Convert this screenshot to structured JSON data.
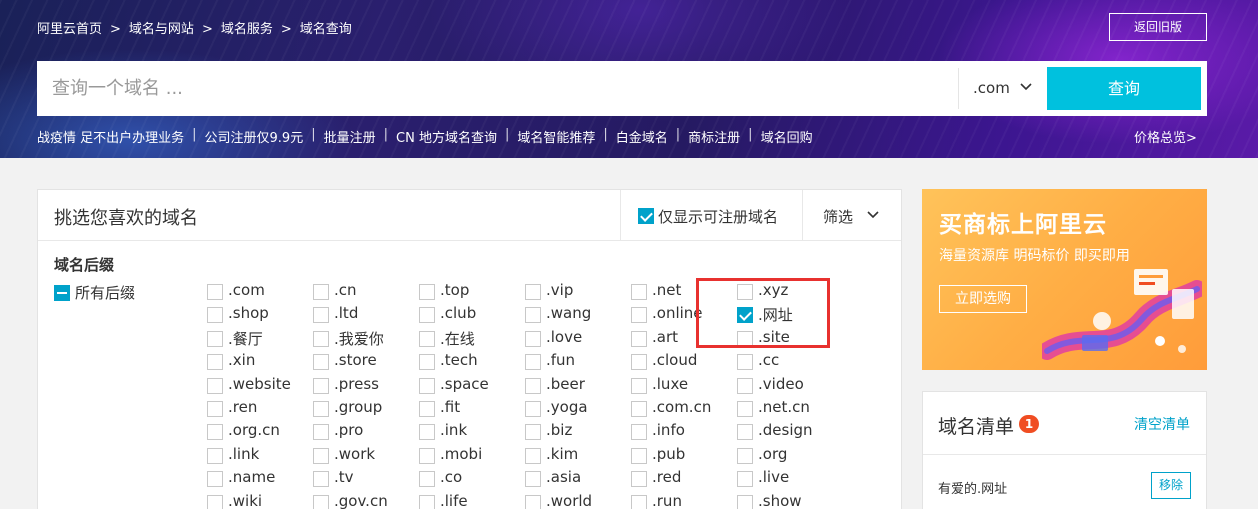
{
  "breadcrumb": [
    "阿里云首页",
    "域名与网站",
    "域名服务",
    "域名查询"
  ],
  "breadcrumb_sep": ">",
  "old_version_label": "返回旧版",
  "search": {
    "placeholder": "查询一个域名 ...",
    "value": "",
    "suffix": ".com",
    "button_label": "查询"
  },
  "quick_links": [
    "战疫情 足不出户办理业务",
    "公司注册仅9.9元",
    "批量注册",
    "CN 地方域名查询",
    "域名智能推荐",
    "白金域名",
    "商标注册",
    "域名回购"
  ],
  "price_link": "价格总览>",
  "panel": {
    "title": "挑选您喜欢的域名",
    "only_registrable_label": "仅显示可注册域名",
    "only_registrable_checked": true,
    "filter_label": "筛选"
  },
  "suffix_section": {
    "title": "域名后缀",
    "all_label": "所有后缀",
    "rows": [
      [
        ".com",
        ".cn",
        ".top",
        ".vip",
        ".net",
        ".xyz"
      ],
      [
        ".shop",
        ".ltd",
        ".club",
        ".wang",
        ".online",
        ".网址"
      ],
      [
        ".餐厅",
        ".我爱你",
        ".在线",
        ".love",
        ".art",
        ".site"
      ],
      [
        ".xin",
        ".store",
        ".tech",
        ".fun",
        ".cloud",
        ".cc"
      ],
      [
        ".website",
        ".press",
        ".space",
        ".beer",
        ".luxe",
        ".video"
      ],
      [
        ".ren",
        ".group",
        ".fit",
        ".yoga",
        ".com.cn",
        ".net.cn"
      ],
      [
        ".org.cn",
        ".pro",
        ".ink",
        ".biz",
        ".info",
        ".design"
      ],
      [
        ".link",
        ".work",
        ".mobi",
        ".kim",
        ".pub",
        ".org"
      ],
      [
        ".name",
        ".tv",
        ".co",
        ".asia",
        ".red",
        ".live"
      ],
      [
        ".wiki",
        ".gov.cn",
        ".life",
        ".world",
        ".run",
        ".show"
      ]
    ],
    "checked": [
      ".网址"
    ]
  },
  "ad": {
    "title": "买商标上阿里云",
    "subtitle": "海量资源库 明码标价 即买即用",
    "button_label": "立即选购"
  },
  "domain_list": {
    "title": "域名清单",
    "count": "1",
    "clear_label": "清空清单",
    "items": [
      {
        "name": "有爱的.网址",
        "remove_label": "移除"
      }
    ]
  },
  "colors": {
    "accent": "#00a2ca",
    "search_button": "#00c1de",
    "badge": "#f04d22",
    "highlight": "#e8312f",
    "ad_bg": "#ffae45"
  }
}
